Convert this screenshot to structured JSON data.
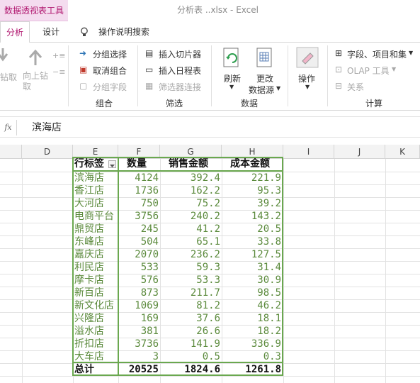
{
  "titlebar": {
    "context_tab": "数据透视表工具",
    "doc_title": "分析表 ..xlsx  -  Excel"
  },
  "tabs": {
    "analyze": "分析",
    "design": "设计",
    "tell_me": "操作说明搜索"
  },
  "ribbon": {
    "drill_down": "钻取",
    "drill_up": "向上钻取",
    "group_selection": "分组选择",
    "ungroup": "取消组合",
    "group_field": "分组字段",
    "group_label": "组合",
    "insert_slicer": "插入切片器",
    "insert_timeline": "插入日程表",
    "filter_connections": "筛选器连接",
    "filter_label": "筛选",
    "refresh": "刷新",
    "change_source_1": "更改",
    "change_source_2": "数据源",
    "data_label": "数据",
    "actions": "操作",
    "fields_items": "字段、项目和集",
    "olap_tools": "OLAP 工具",
    "relationships": "关系",
    "calc_label": "计算"
  },
  "formula": {
    "fx": "fx",
    "value": "滨海店"
  },
  "columns": [
    "D",
    "E",
    "F",
    "G",
    "H",
    "I",
    "J",
    "K"
  ],
  "pivot": {
    "header": [
      "行标签",
      "数量",
      "销售金额",
      "成本金额"
    ],
    "rows": [
      [
        "滨海店",
        "4124",
        "392.4",
        "221.9"
      ],
      [
        "香江店",
        "1736",
        "162.2",
        "95.3"
      ],
      [
        "大河店",
        "750",
        "75.2",
        "39.2"
      ],
      [
        "电商平台",
        "3756",
        "240.2",
        "143.2"
      ],
      [
        "鼎贸店",
        "245",
        "41.2",
        "20.5"
      ],
      [
        "东峰店",
        "504",
        "65.1",
        "33.8"
      ],
      [
        "嘉庆店",
        "2070",
        "236.2",
        "127.5"
      ],
      [
        "利民店",
        "533",
        "59.3",
        "31.4"
      ],
      [
        "摩卡店",
        "576",
        "53.3",
        "30.9"
      ],
      [
        "新百店",
        "873",
        "211.7",
        "98.5"
      ],
      [
        "新文化店",
        "1069",
        "81.2",
        "46.2"
      ],
      [
        "兴隆店",
        "169",
        "37.6",
        "18.1"
      ],
      [
        "溢水店",
        "381",
        "26.6",
        "18.2"
      ],
      [
        "折扣店",
        "3736",
        "141.9",
        "336.9"
      ],
      [
        "大车店",
        "3",
        "0.5",
        "0.3"
      ]
    ],
    "total": [
      "总计",
      "20525",
      "1824.6",
      "1261.8"
    ]
  },
  "colors": {
    "accent": "#b0156e",
    "pivot_border": "#6aa84f",
    "cell_text": "#5b8a3c"
  }
}
